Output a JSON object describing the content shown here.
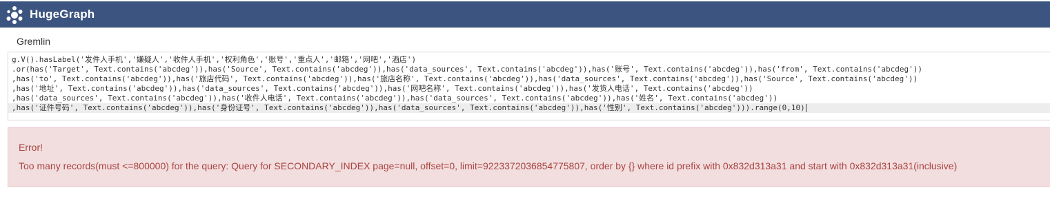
{
  "app": {
    "name": "HugeGraph",
    "colors": {
      "header_bg": "#3c5580",
      "error_bg": "#f2dede",
      "error_text": "#a94442"
    }
  },
  "query_panel": {
    "label": "Gremlin",
    "code_lines": [
      "g.V().hasLabel('发件人手机','嫌疑人','收件人手机','权利角色','账号','重点人','邮箱','网吧','酒店')",
      ".or(has('Target', Text.contains('abcdeg')),has('Source', Text.contains('abcdeg')),has('data_sources', Text.contains('abcdeg')),has('账号', Text.contains('abcdeg')),has('from', Text.contains('abcdeg'))",
      ",has('to', Text.contains('abcdeg')),has('旅店代码', Text.contains('abcdeg')),has('旅店名称', Text.contains('abcdeg')),has('data_sources', Text.contains('abcdeg')),has('Source', Text.contains('abcdeg'))",
      ",has('地址', Text.contains('abcdeg')),has('data_sources', Text.contains('abcdeg')),has('网吧名称', Text.contains('abcdeg')),has('发货人电话', Text.contains('abcdeg'))",
      ",has('data_sources', Text.contains('abcdeg')),has('收件人电话', Text.contains('abcdeg')),has('data_sources', Text.contains('abcdeg')),has('姓名', Text.contains('abcdeg'))",
      ",has('证件号码', Text.contains('abcdeg')),has('身份证号', Text.contains('abcdeg')),has('data_sources', Text.contains('abcdeg')),has('性别', Text.contains('abcdeg'))).range(0,10)"
    ]
  },
  "error": {
    "title": "Error!",
    "message": "Too many records(must <=800000) for the query: Query for SECONDARY_INDEX page=null, offset=0, limit=9223372036854775807, order by {} where id prefix with 0x832d313a31 and start with 0x832d313a31(inclusive)"
  }
}
